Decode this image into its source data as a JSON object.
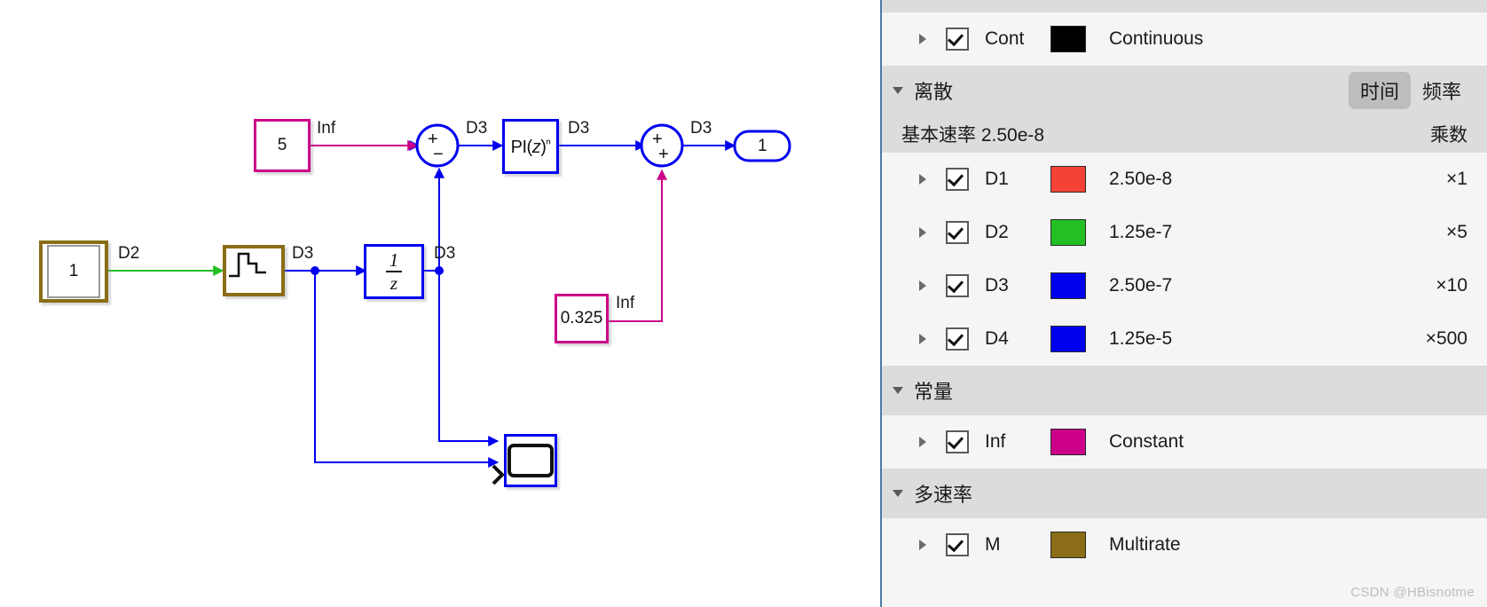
{
  "canvas": {
    "blocks": [
      {
        "name": "constant-5",
        "label": "5"
      },
      {
        "name": "inport-1",
        "label": "1"
      },
      {
        "name": "unit-delay",
        "label": "1/z"
      },
      {
        "name": "pi-controller",
        "label": "PI(z)"
      },
      {
        "name": "constant-0325",
        "label": "0.325"
      },
      {
        "name": "outport-1",
        "label": "1"
      }
    ],
    "signal_labels": {
      "const5_to_sum": "Inf",
      "sum_to_pi": "D3",
      "pi_to_sum2": "D3",
      "sum2_to_out": "D3",
      "inport_to_step": "D2",
      "step_to_delay": "D3",
      "delay_out": "D3",
      "const0325_to_sum2": "Inf"
    },
    "sum_signs": {
      "sum1_top": "+",
      "sum1_bottom": "−",
      "sum2_top": "+",
      "sum2_bottom": "+"
    }
  },
  "panel": {
    "continuous_row": {
      "id": "Cont",
      "color": "#000000",
      "description": "Continuous",
      "checked": true
    },
    "discrete_group": {
      "title": "离散",
      "toggle": {
        "time": "时间",
        "frequency": "频率",
        "selected": "时间"
      },
      "base_rate_label": "基本速率 2.50e-8",
      "multiplier_header": "乘数",
      "rows": [
        {
          "id": "D1",
          "color": "#f44336",
          "value": "2.50e-8",
          "multiplier": "×1",
          "checked": true
        },
        {
          "id": "D2",
          "color": "#22c022",
          "value": "1.25e-7",
          "multiplier": "×5",
          "checked": true
        },
        {
          "id": "D3",
          "color": "#0000f0",
          "value": "2.50e-7",
          "multiplier": "×10",
          "checked": true
        },
        {
          "id": "D4",
          "color": "#0000f0",
          "value": "1.25e-5",
          "multiplier": "×500",
          "checked": true
        }
      ]
    },
    "constant_group": {
      "title": "常量",
      "rows": [
        {
          "id": "Inf",
          "color": "#cc0088",
          "description": "Constant",
          "checked": true
        }
      ]
    },
    "multirate_group": {
      "title": "多速率",
      "rows": [
        {
          "id": "M",
          "color": "#8a6d16",
          "description": "Multirate",
          "checked": true
        }
      ]
    },
    "watermark": "CSDN @HBisnotme"
  }
}
